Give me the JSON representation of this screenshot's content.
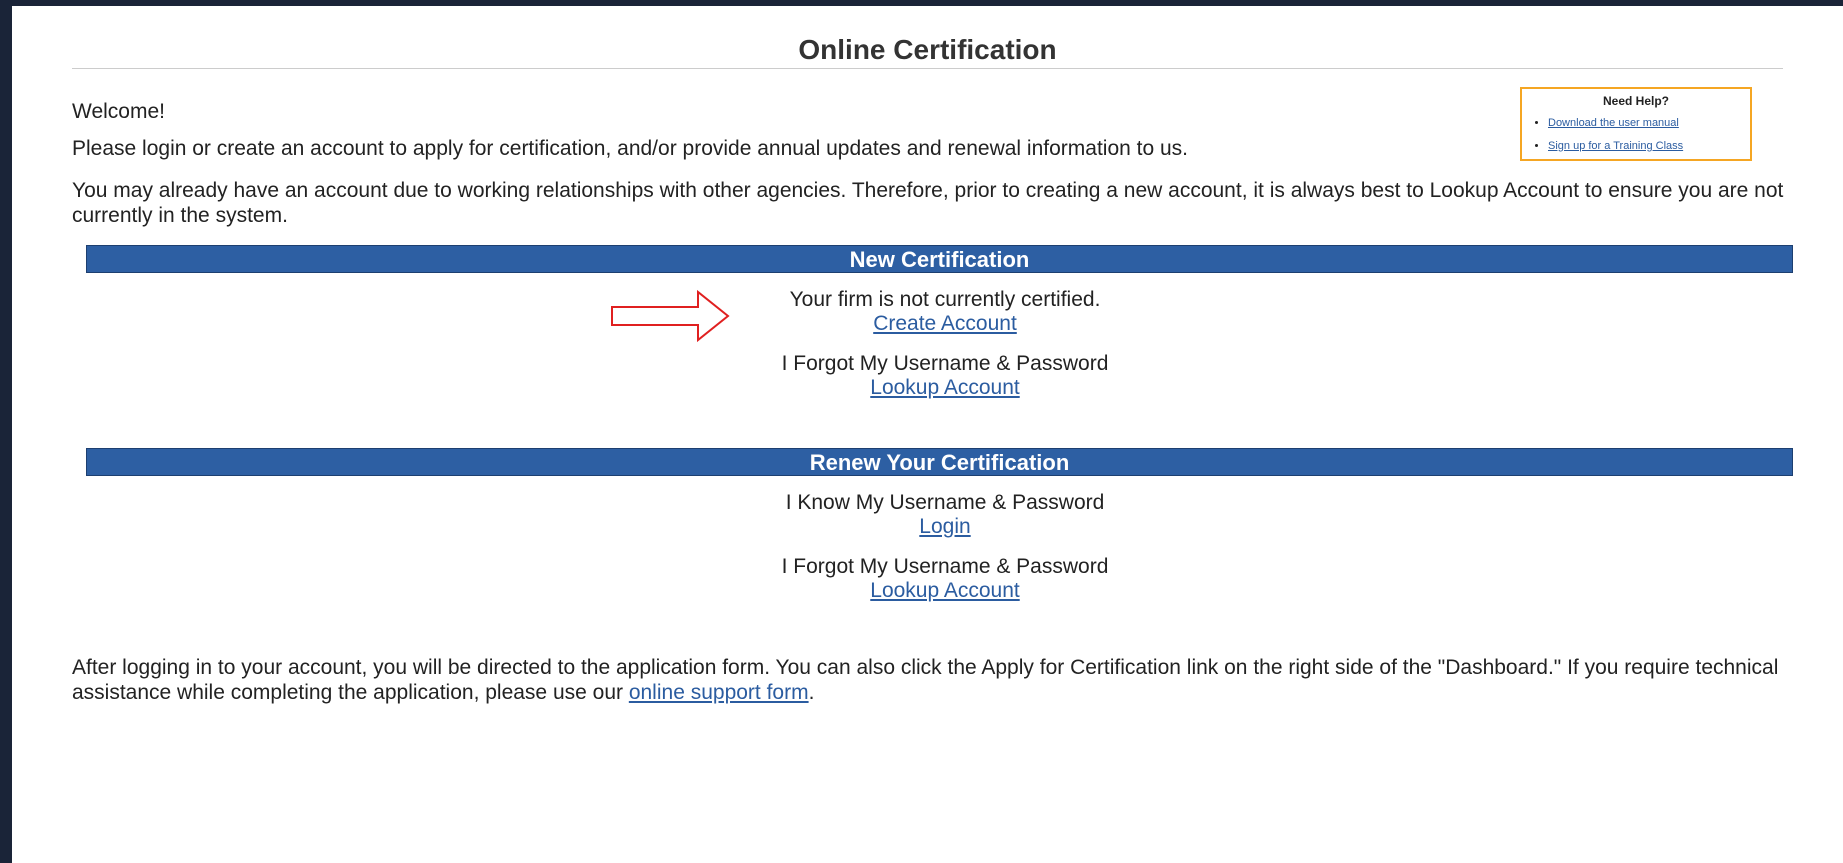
{
  "page": {
    "title": "Online Certification",
    "welcome": "Welcome!",
    "intro": "Please login or create an account to apply for certification, and/or provide annual updates and renewal information to us.",
    "notice": "You may already have an account due to working relationships with other agencies. Therefore, prior to creating a new account, it is always best to Lookup Account to ensure you are not currently in the system."
  },
  "help": {
    "heading": "Need Help?",
    "links": [
      "Download the user manual",
      "Sign up for a Training Class"
    ]
  },
  "new_cert": {
    "heading": "New Certification",
    "status_text": "Your firm is not currently certified.",
    "create_link": "Create Account",
    "forgot_text": "I Forgot My Username & Password",
    "lookup_link": "Lookup Account"
  },
  "renew": {
    "heading": "Renew Your Certification",
    "know_text": "I Know My Username & Password",
    "login_link": "Login",
    "forgot_text": "I Forgot My Username & Password",
    "lookup_link": "Lookup Account"
  },
  "footer": {
    "text_before": "After logging in to your account, you will be directed to the application form. You can also click the Apply for Certification link on the right side of the \"Dashboard.\" If you require technical assistance while completing the application, please use our ",
    "support_link": "online support form",
    "text_after": "."
  },
  "colors": {
    "band": "#2d5fa3",
    "link": "#2b5ca0",
    "help_border": "#f5a623",
    "arrow": "#e02020"
  }
}
